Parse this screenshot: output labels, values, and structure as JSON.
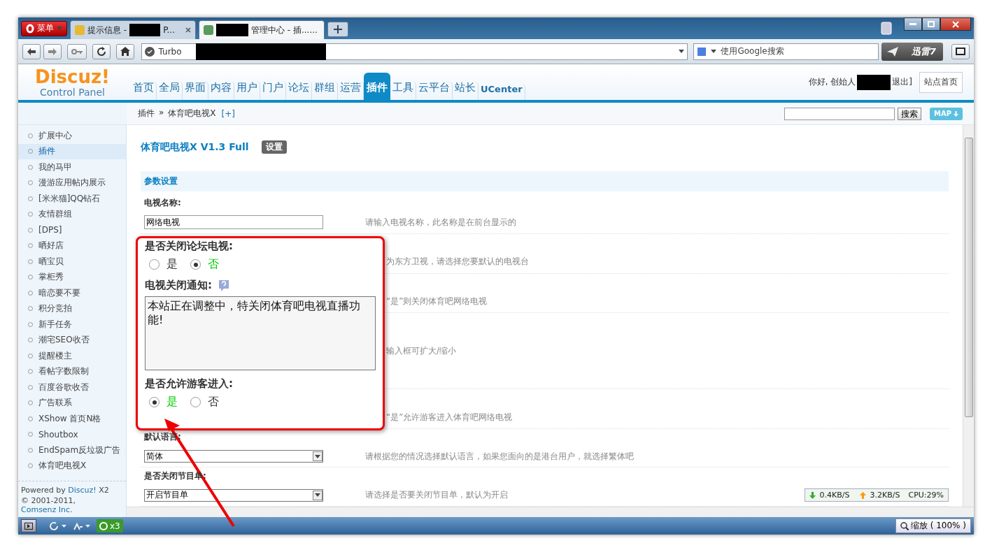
{
  "browser": {
    "menu_label": "菜单",
    "tabs": [
      {
        "title": "提示信息 -",
        "title_tail": "P...",
        "redacted": true,
        "selected": false
      },
      {
        "title": "管理中心 - 插......",
        "redacted": true,
        "selected": true
      }
    ],
    "address": {
      "prefix": "Turbo"
    },
    "search": {
      "placeholder": "使用Google搜索"
    },
    "badge": "迅雷7"
  },
  "header": {
    "logo": "Discuz!",
    "subtitle": "Control Panel",
    "nav": [
      {
        "label": "首页",
        "selected": false
      },
      {
        "label": "全局",
        "selected": false
      },
      {
        "label": "界面",
        "selected": false
      },
      {
        "label": "内容",
        "selected": false
      },
      {
        "label": "用户",
        "selected": false
      },
      {
        "label": "门户",
        "selected": false
      },
      {
        "label": "论坛",
        "selected": false
      },
      {
        "label": "群组",
        "selected": false
      },
      {
        "label": "运营",
        "selected": false
      },
      {
        "label": "插件",
        "selected": true
      },
      {
        "label": "工具",
        "selected": false
      },
      {
        "label": "云平台",
        "selected": false
      },
      {
        "label": "站长",
        "selected": false
      },
      {
        "label": "UCenter",
        "selected": false
      }
    ],
    "greeting": "你好, 创始人",
    "logout": "退出]",
    "home_button": "站点首页"
  },
  "breadcrumb": {
    "items": [
      "插件",
      "体育吧电视X"
    ],
    "separator": "»",
    "add": "[+]",
    "search_button": "搜索",
    "map_button": "MAP"
  },
  "sidebar": {
    "items": [
      {
        "label": "扩展中心",
        "selected": false
      },
      {
        "label": "插件",
        "selected": true
      },
      {
        "label": "我的马甲",
        "selected": false
      },
      {
        "label": "漫游应用帖内展示",
        "selected": false
      },
      {
        "label": "[米米猫]QQ钻石",
        "selected": false
      },
      {
        "label": "友情群组",
        "selected": false
      },
      {
        "label": "[DPS]",
        "selected": false
      },
      {
        "label": "晒好店",
        "selected": false
      },
      {
        "label": "晒宝贝",
        "selected": false
      },
      {
        "label": "掌柜秀",
        "selected": false
      },
      {
        "label": "暗恋要不要",
        "selected": false
      },
      {
        "label": "积分竞拍",
        "selected": false
      },
      {
        "label": "新手任务",
        "selected": false
      },
      {
        "label": "潮宅SEO收否",
        "selected": false
      },
      {
        "label": "提醒楼主",
        "selected": false
      },
      {
        "label": "看帖字数限制",
        "selected": false
      },
      {
        "label": "百度谷歌收否",
        "selected": false
      },
      {
        "label": "广告联系",
        "selected": false
      },
      {
        "label": "XShow 首页N格",
        "selected": false
      },
      {
        "label": "Shoutbox",
        "selected": false
      },
      {
        "label": "EndSpam反垃圾广告",
        "selected": false
      },
      {
        "label": "体育吧电视X",
        "selected": false
      }
    ],
    "powered": {
      "before": "Powered by",
      "link": "Discuz!",
      "after": "X2"
    },
    "copyright": {
      "before": "© 2001-2011,",
      "link": "Comsenz Inc."
    }
  },
  "content": {
    "title": "体育吧电视X V1.3 Full",
    "settings_button": "设置",
    "section": "参数设置",
    "rows": [
      {
        "kind": "input",
        "label": "电视名称:",
        "value": "网络电视",
        "hint": "请输入电视名称，此名称是在前台显示的"
      },
      {
        "kind": "hint",
        "hint": "为东方卫视，请选择您要默认的电视台"
      },
      {
        "kind": "hint",
        "hint": "“是”则关闭体育吧网络电视"
      },
      {
        "kind": "tall",
        "hint": "输入框可扩大/缩小"
      },
      {
        "kind": "hint",
        "hint": "“是”允许游客进入体育吧网络电视"
      },
      {
        "kind": "select",
        "label": "默认语言:",
        "value": "简体",
        "hint": "请根据您的情况选择默认语言，如果您面向的是港台用户，就选择繁体吧"
      },
      {
        "kind": "select",
        "label": "是否关闭节目单:",
        "value": "开启节目单",
        "hint": "请选择是否要关闭节目单，默认为开启"
      }
    ]
  },
  "callout": {
    "fields": [
      {
        "kind": "radio",
        "label": "是否关闭论坛电视:",
        "options": [
          {
            "label": "是",
            "selected": false
          },
          {
            "label": "否",
            "selected": true
          }
        ]
      },
      {
        "kind": "textarea",
        "label": "电视关闭通知:",
        "value": "本站正在调整中，特关闭体育吧电视直播功能!"
      },
      {
        "kind": "radio",
        "label": "是否允许游客进入:",
        "options": [
          {
            "label": "是",
            "selected": true
          },
          {
            "label": "否",
            "selected": false
          }
        ]
      }
    ]
  },
  "status_bar": {
    "count": "x3",
    "download": "0.4KB/S",
    "upload": "3.2KB/S",
    "cpu": "CPU:29%",
    "zoom": "缩放 ( 100% )"
  }
}
